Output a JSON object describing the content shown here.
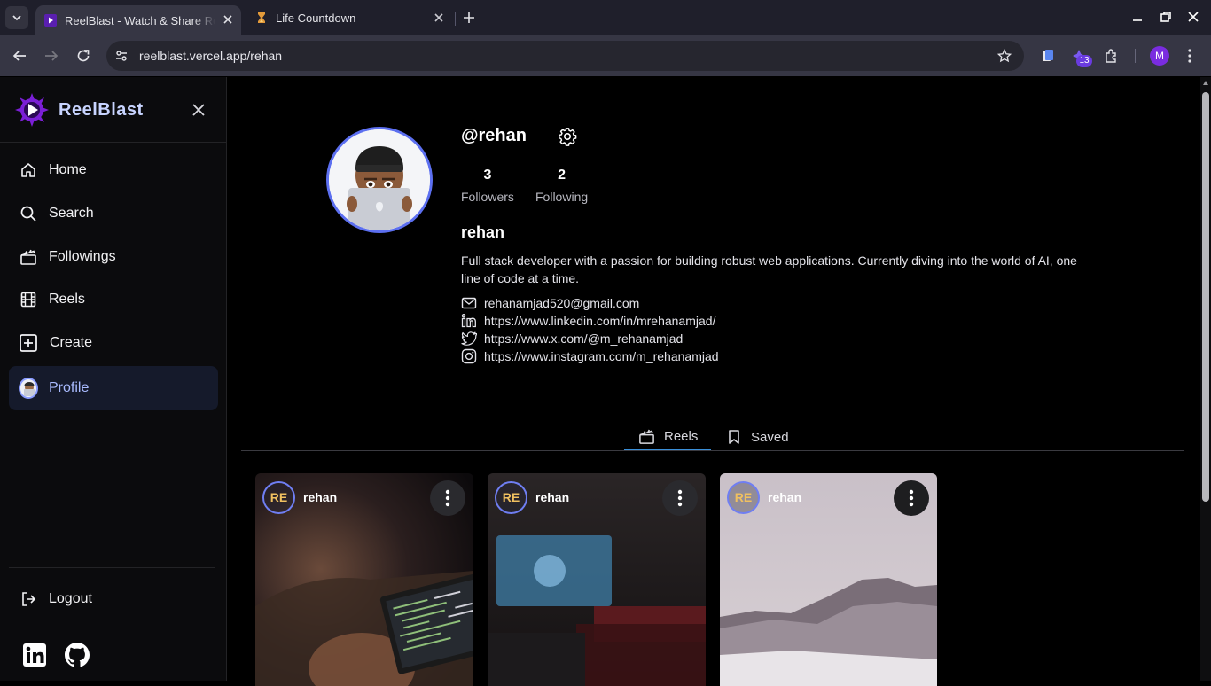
{
  "browser": {
    "tabs": [
      {
        "title": "ReelBlast - Watch & Share Reels",
        "active": true
      },
      {
        "title": "Life Countdown",
        "active": false
      }
    ],
    "url": "reelblast.vercel.app/rehan",
    "extension_badge": "13",
    "profile_initial": "M"
  },
  "sidebar": {
    "brand": "ReelBlast",
    "nav": [
      {
        "label": "Home",
        "icon": "home-icon"
      },
      {
        "label": "Search",
        "icon": "search-icon"
      },
      {
        "label": "Followings",
        "icon": "clapperboard-icon"
      },
      {
        "label": "Reels",
        "icon": "film-icon"
      },
      {
        "label": "Create",
        "icon": "plus-square-icon"
      },
      {
        "label": "Profile",
        "icon": "avatar",
        "active": true
      }
    ],
    "logout": "Logout"
  },
  "profile": {
    "handle": "@rehan",
    "followers_count": "3",
    "followers_label": "Followers",
    "following_count": "2",
    "following_label": "Following",
    "name": "rehan",
    "bio": "Full stack developer with a passion for building robust web applications. Currently diving into the world of AI, one line of code at a time.",
    "email": "rehanamjad520@gmail.com",
    "linkedin": "https://www.linkedin.com/in/mrehanamjad/",
    "x": "https://www.x.com/@m_rehanamjad",
    "instagram": "https://www.instagram.com/m_rehanamjad"
  },
  "tabs": {
    "reels": "Reels",
    "saved": "Saved"
  },
  "reels": [
    {
      "initials": "RE",
      "user": "rehan"
    },
    {
      "initials": "RE",
      "user": "rehan"
    },
    {
      "initials": "RE",
      "user": "rehan"
    }
  ],
  "colors": {
    "accent": "#5c6ff0",
    "active_nav_bg": "#151a2b",
    "tab_underline": "#3a8fd8"
  }
}
